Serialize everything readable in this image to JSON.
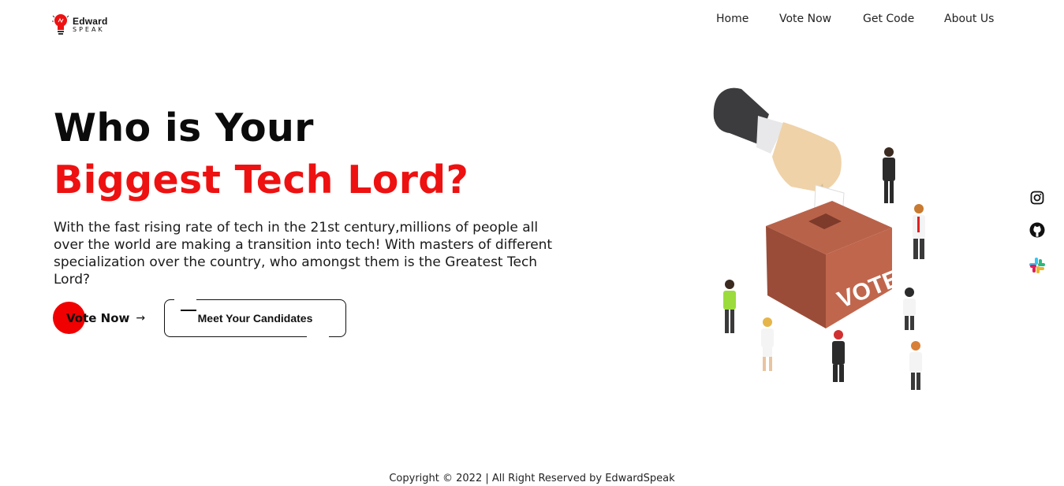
{
  "brand": {
    "name_top": "Edward",
    "name_bottom": "SPEAK",
    "icon": "lightbulb-icon",
    "accent": "#ee1111"
  },
  "nav": {
    "items": [
      {
        "label": "Home"
      },
      {
        "label": "Vote Now"
      },
      {
        "label": "Get Code"
      },
      {
        "label": "About Us"
      }
    ]
  },
  "hero": {
    "title_line1": "Who is Your",
    "title_line2": "Biggest Tech Lord?",
    "description": "With the fast rising rate of tech in the 21st century,millions of people all over the world are making a transition into tech! With masters of different specialization over the country, who amongst them is the Greatest Tech Lord?",
    "vote_button": "Vote Now",
    "vote_arrow": "→",
    "meet_button": "Meet Your Candidates",
    "illustration_text": "VOTE"
  },
  "social": [
    {
      "icon": "instagram-icon"
    },
    {
      "icon": "github-icon"
    },
    {
      "icon": "slack-icon"
    }
  ],
  "footer": {
    "copyright": "Copyright © 2022 | All Right Reserved by EdwardSpeak"
  }
}
